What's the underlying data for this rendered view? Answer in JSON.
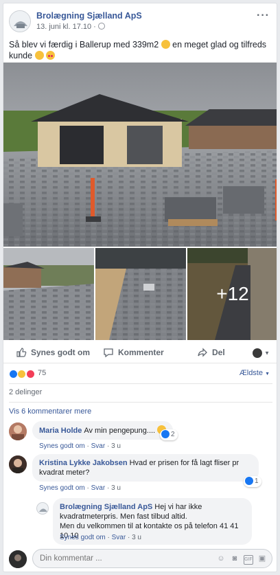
{
  "post": {
    "author": "Brolægning Sjælland ApS",
    "timestamp": "13. juni kl. 17.10 ·",
    "text": "Så blev vi færdig i Ballerup med 339m2",
    "text2": "en meget glad og tilfreds kunde",
    "more_label": "···",
    "extra_photos": "+12"
  },
  "actions": {
    "like": "Synes godt om",
    "comment": "Kommenter",
    "share": "Del"
  },
  "reactions": {
    "count": "75",
    "sort": "Ældste",
    "shares": "2 delinger",
    "previous": "Vis 6 kommentarer mere"
  },
  "comments": [
    {
      "name": "Maria Holde",
      "text": "Av min pengepung....",
      "likes": "2",
      "like_label": "Synes godt om",
      "reply_label": "Svar",
      "age": "3 u"
    },
    {
      "name": "Kristina Lykke Jakobsen",
      "text": "Hvad er prisen for få lagt fliser pr kvadrat meter?",
      "likes": "1",
      "like_label": "Synes godt om",
      "reply_label": "Svar",
      "age": "3 u"
    }
  ],
  "reply": {
    "name": "Brolægning Sjælland ApS",
    "line1": "Hej vi har ikke kvadratmeterpris. Men fast tilbud altid.",
    "line2": "Men du velkommen til at kontakte os på telefon 41 41 10 10",
    "like_label": "Synes godt om",
    "reply_label": "Svar",
    "age": "3 u"
  },
  "composer": {
    "placeholder": "Din kommentar ..."
  },
  "colors": {
    "link": "#385898",
    "like_blue": "#1877f2",
    "love_red": "#f33e58",
    "wow_yellow": "#f7c13c"
  }
}
